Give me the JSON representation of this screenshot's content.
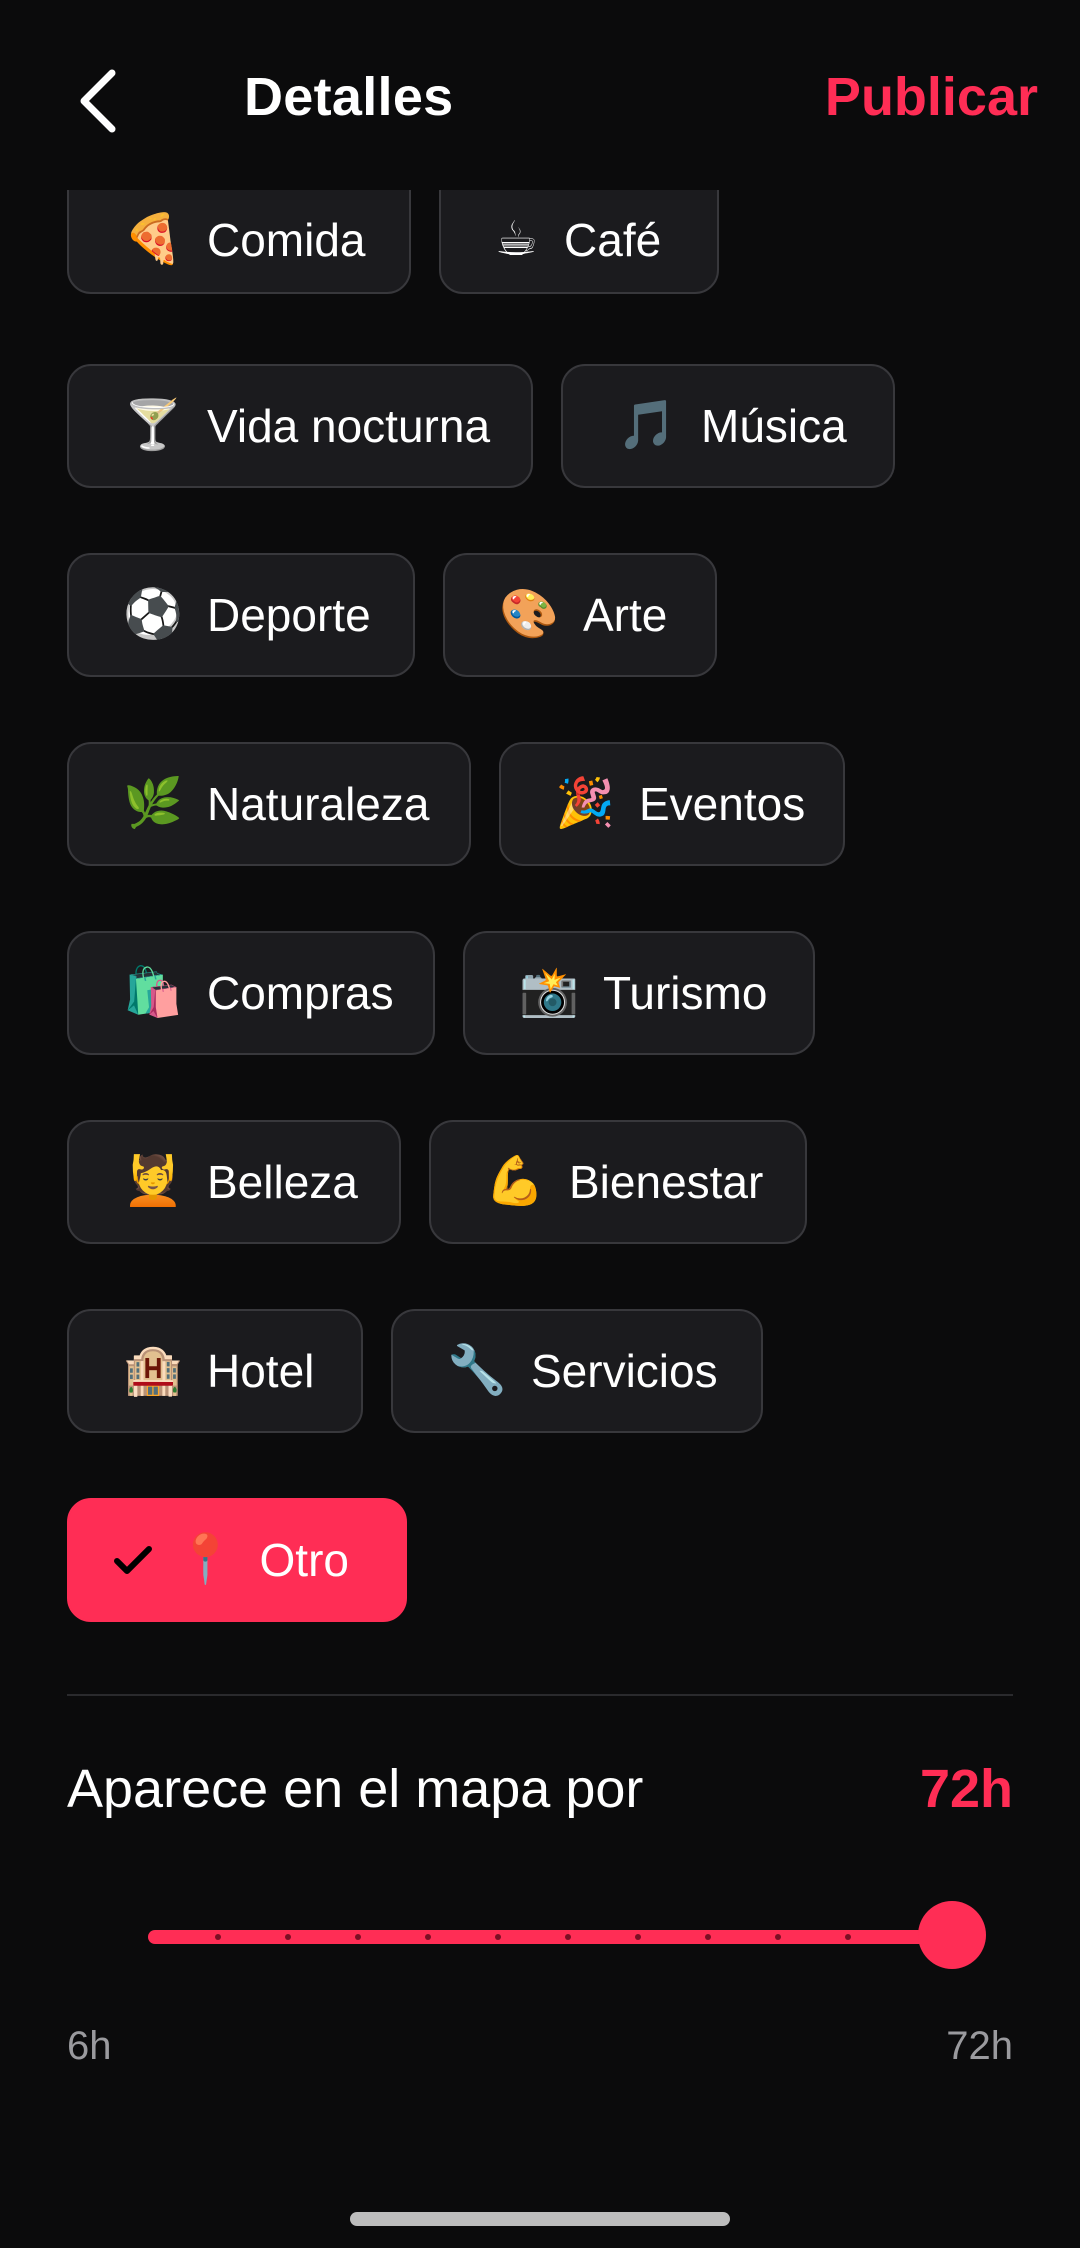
{
  "header": {
    "title": "Detalles",
    "publish_label": "Publicar"
  },
  "categories": [
    {
      "emoji": "🍕",
      "label": "Comida",
      "selected": false
    },
    {
      "emoji": "☕",
      "label": "Café",
      "selected": false
    },
    {
      "emoji": "🍸",
      "label": "Vida nocturna",
      "selected": false
    },
    {
      "emoji": "🎵",
      "label": "Música",
      "selected": false
    },
    {
      "emoji": "⚽",
      "label": "Deporte",
      "selected": false
    },
    {
      "emoji": "🎨",
      "label": "Arte",
      "selected": false
    },
    {
      "emoji": "🌿",
      "label": "Naturaleza",
      "selected": false
    },
    {
      "emoji": "🎉",
      "label": "Eventos",
      "selected": false
    },
    {
      "emoji": "🛍️",
      "label": "Compras",
      "selected": false
    },
    {
      "emoji": "📸",
      "label": "Turismo",
      "selected": false
    },
    {
      "emoji": "💆",
      "label": "Belleza",
      "selected": false
    },
    {
      "emoji": "💪",
      "label": "Bienestar",
      "selected": false
    },
    {
      "emoji": "🏨",
      "label": "Hotel",
      "selected": false
    },
    {
      "emoji": "🔧",
      "label": "Servicios",
      "selected": false
    },
    {
      "emoji": "📍",
      "label": "Otro",
      "selected": true
    }
  ],
  "duration": {
    "title": "Aparece en el mapa por",
    "value_label": "72h",
    "min_label": "6h",
    "max_label": "72h",
    "min": 6,
    "max": 72,
    "value": 72,
    "steps": 11
  },
  "colors": {
    "accent": "#ff2d55",
    "background": "#0b0b0c",
    "chip_background": "#1b1b1e"
  }
}
